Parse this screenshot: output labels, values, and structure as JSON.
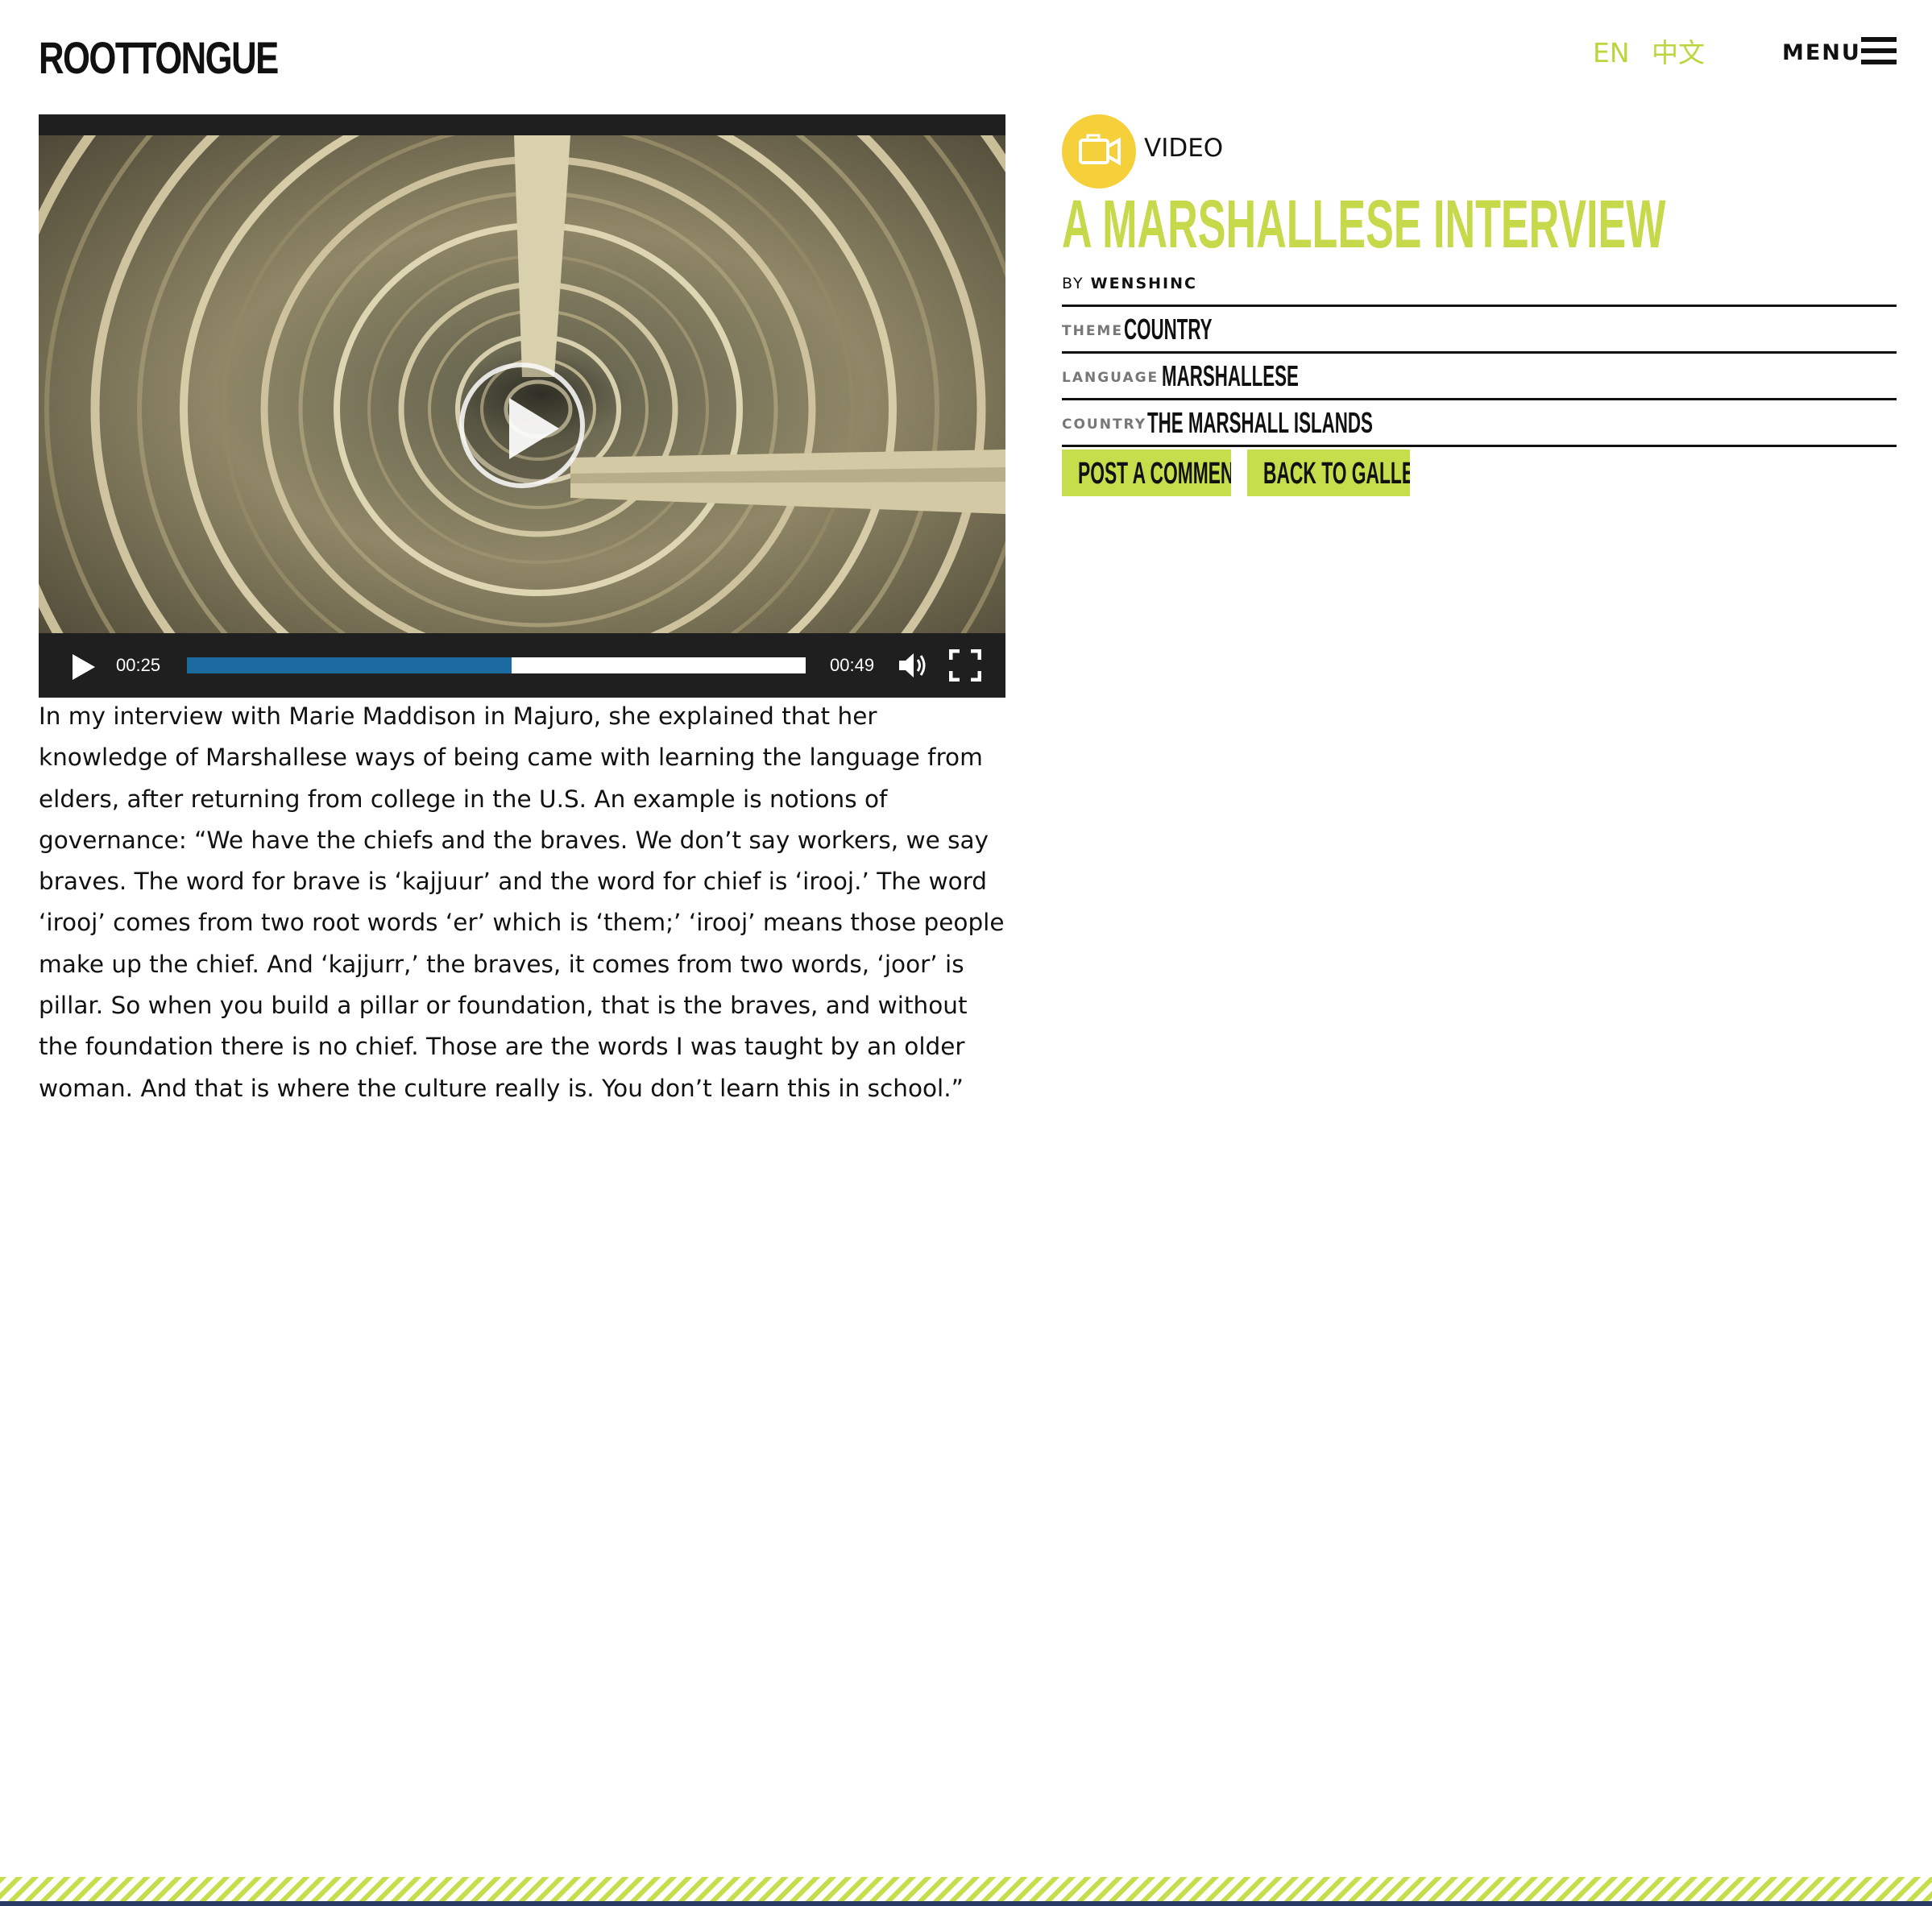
{
  "header": {
    "logo": "ROOTTONGUE",
    "languages": [
      "EN",
      "中文"
    ],
    "menu_label": "MENU"
  },
  "video": {
    "current_time": "00:25",
    "duration": "00:49",
    "progress_fraction": 0.525
  },
  "post": {
    "type_label": "VIDEO",
    "title": "A MARSHALLESE INTERVIEW",
    "by_label": "BY",
    "author": "WENSHINC",
    "meta": [
      {
        "key": "THEME",
        "value": "COUNTRY"
      },
      {
        "key": "LANGUAGE",
        "value": "MARSHALLESE"
      },
      {
        "key": "COUNTRY",
        "value": "THE MARSHALL ISLANDS"
      }
    ],
    "buttons": {
      "post_comment": "POST A COMMENT",
      "back_to_gallery": "BACK TO GALLERY"
    },
    "body": "In my interview with Marie Maddison in Majuro, she explained that her knowledge of Marshallese ways of being came with learning the language from elders, after returning from college in the U.S. An example is notions of governance: “We have the chiefs and the braves. We don’t say workers, we say braves. The word for brave is ‘kajjuur’ and the word for chief is ‘irooj.’ The word ‘irooj’ comes from two root words ‘er’ which is ‘them;’ ‘irooj’ means those people make up the chief. And ‘kajjurr,’ the braves, it comes from two words, ‘joor’ is pillar. So when you build a pillar or foundation, that is the braves, and without the foundation there is no chief. Those are the words I was taught by an older woman. And that is where the culture really is. You don’t learn this in school.”"
  },
  "colors": {
    "accent": "#c6d94a",
    "video_badge": "#f5d03a",
    "progress": "#1b6aa0",
    "player_bg": "#1f1f1f"
  },
  "icons": [
    "hamburger-icon",
    "video-camera-icon",
    "play-icon",
    "volume-icon",
    "fullscreen-icon"
  ]
}
